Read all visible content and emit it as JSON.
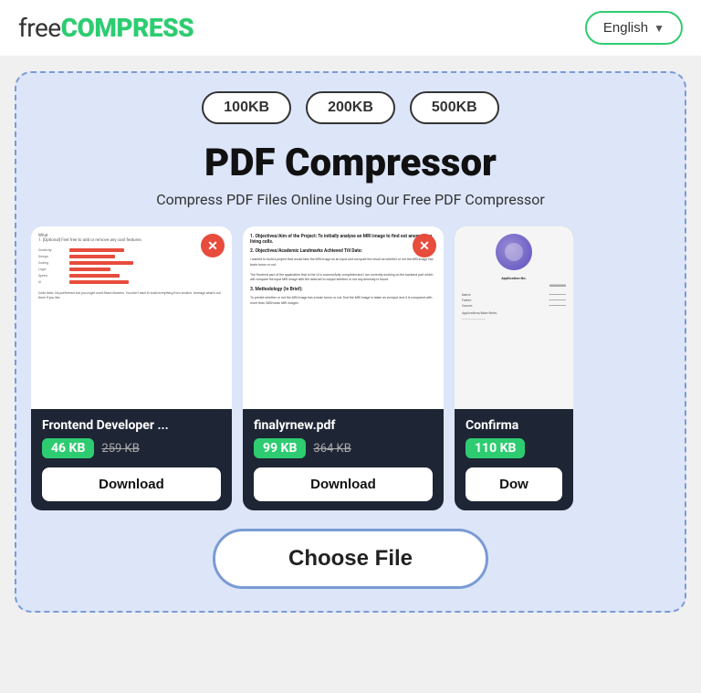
{
  "header": {
    "logo_free": "free",
    "logo_compress": "COMPRESS",
    "lang_label": "English",
    "lang_chevron": "▼"
  },
  "compressor": {
    "size_buttons": [
      "100KB",
      "200KB",
      "500KB"
    ],
    "main_title": "PDF Compressor",
    "subtitle": "Compress PDF Files Online Using Our Free PDF Compressor",
    "files": [
      {
        "name": "Frontend Developer ...",
        "size_new": "46 KB",
        "size_old": "259 KB",
        "download_label": "Download"
      },
      {
        "name": "finalyrnew.pdf",
        "size_new": "99 KB",
        "size_old": "364 KB",
        "download_label": "Download"
      },
      {
        "name": "Confirma",
        "size_new": "110 KB",
        "size_old": "",
        "download_label": "Dow"
      }
    ],
    "choose_file_label": "Choose File"
  }
}
